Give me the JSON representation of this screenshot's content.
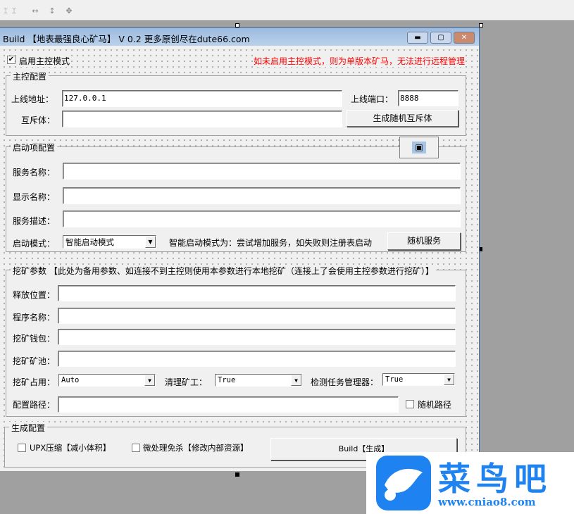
{
  "window": {
    "title": "Build 【地表最强良心矿马】 V 0.2  更多原创尽在dute66.com",
    "min": "▬",
    "max": "▢",
    "close": "✕"
  },
  "master_mode": {
    "label": "启用主控模式",
    "checked": true,
    "warning": "如未启用主控模式，则为单版本矿马，无法进行远程管理",
    "warning_color": "#ff0000"
  },
  "master": {
    "title": "主控配置",
    "addr_label": "上线地址：",
    "addr_value": "127.0.0.1",
    "port_label": "上线端口：",
    "port_value": "8888",
    "mutex_label": "互斥体：",
    "mutex_value": "",
    "gen_mutex": "生成随机互斥体"
  },
  "startup": {
    "title": "启动项配置",
    "service_name_label": "服务名称：",
    "display_name_label": "显示名称：",
    "desc_label": "服务描述：",
    "mode_label": "启动模式：",
    "mode_value": "智能启动模式",
    "mode_hint": "智能启动模式为：尝试增加服务，如失败则注册表启动",
    "random_service": "随机服务"
  },
  "mining": {
    "title": "挖矿参数 【此处为备用参数、如连接不到主控则使用本参数进行本地挖矿（连接上了会使用主控参数进行挖矿）】",
    "release_label": "释放位置：",
    "program_label": "程序名称：",
    "wallet_label": "挖矿钱包：",
    "pool_label": "挖矿矿池：",
    "usage_label": "挖矿占用：",
    "usage_value": "Auto",
    "clean_label": "清理矿工：",
    "clean_value": "True",
    "taskmgr_label": "检测任务管理器：",
    "taskmgr_value": "True",
    "config_label": "配置路径：",
    "random_path": "随机路径"
  },
  "build": {
    "title": "生成配置",
    "upx": "UPX压缩【减小体积】",
    "avoid": "微处理免杀【修改内部资源】",
    "build_button": "Build【生成】"
  },
  "watermark": {
    "brand": "菜鸟吧",
    "url": "www.cniao8.com",
    "color": "#1e82f0"
  }
}
